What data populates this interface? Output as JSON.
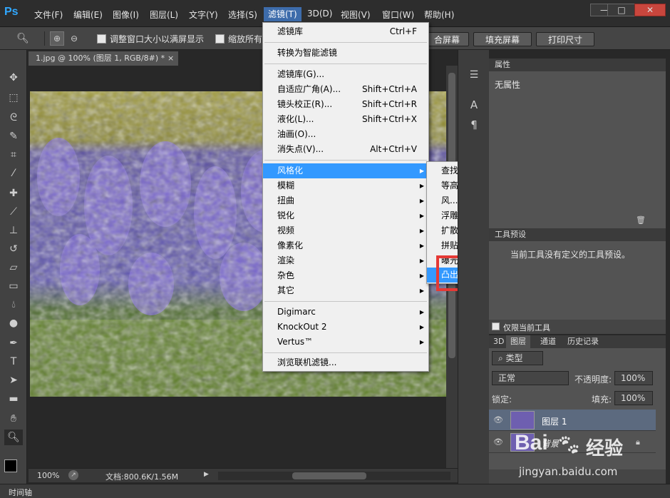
{
  "app": {
    "logo": "Ps"
  },
  "menubar": {
    "items": [
      "文件(F)",
      "编辑(E)",
      "图像(I)",
      "图层(L)",
      "文字(Y)",
      "选择(S)",
      "滤镜(T)",
      "3D(D)",
      "视图(V)",
      "窗口(W)",
      "帮助(H)"
    ]
  },
  "window_buttons": {
    "min": "—",
    "restore": "□",
    "close": "✕"
  },
  "options": {
    "resize_window": "调整窗口大小以满屏显示",
    "zoom_all": "缩放所有",
    "fit_screen": "合屏幕",
    "fill_screen": "填充屏幕",
    "print_size": "打印尺寸"
  },
  "document": {
    "tab": "1.jpg @ 100% (图层 1, RGB/8#) *",
    "tab_close": "×"
  },
  "status": {
    "zoom": "100%",
    "doc": "文档:800.6K/1.56M"
  },
  "timeline": {
    "label": "时间轴"
  },
  "filter_menu": {
    "filter_gallery_top": "滤镜库",
    "filter_gallery_top_sc": "Ctrl+F",
    "smart_filter": "转换为智能滤镜",
    "filter_gallery": "滤镜库(G)...",
    "adaptive_wide": "自适应广角(A)...",
    "adaptive_wide_sc": "Shift+Ctrl+A",
    "lens_correction": "镜头校正(R)...",
    "lens_correction_sc": "Shift+Ctrl+R",
    "liquify": "液化(L)...",
    "liquify_sc": "Shift+Ctrl+X",
    "oil_paint": "油画(O)...",
    "vanishing_point": "消失点(V)...",
    "vanishing_point_sc": "Alt+Ctrl+V",
    "stylize": "风格化",
    "blur": "模糊",
    "distort": "扭曲",
    "sharpen": "锐化",
    "video": "视频",
    "pixelate": "像素化",
    "render": "渲染",
    "noise": "杂色",
    "other": "其它",
    "digimarc": "Digimarc",
    "knockout": "KnockOut 2",
    "vertus": "Vertus™",
    "browse_online": "浏览联机滤镜..."
  },
  "stylize_menu": {
    "items": [
      "查找边缘",
      "等高线...",
      "风...",
      "浮雕效果...",
      "扩散...",
      "拼贴...",
      "曝光过度",
      "凸出..."
    ]
  },
  "properties": {
    "tab": "属性",
    "text": "无属性"
  },
  "tool_presets": {
    "tab": "工具预设",
    "text": "当前工具没有定义的工具预设。",
    "current_only": "仅限当前工具"
  },
  "layers_panel": {
    "tabs": [
      "3D",
      "图层",
      "通道",
      "历史记录"
    ],
    "kind": "类型",
    "blend": "正常",
    "opacity_label": "不透明度:",
    "opacity": "100%",
    "lock_label": "锁定:",
    "fill_label": "填充:",
    "fill": "100%",
    "layers": [
      {
        "name": "图层 1"
      },
      {
        "name": "背景"
      }
    ]
  },
  "watermark": {
    "brand": "Bai",
    "brand2": "经验",
    "url": "jingyan.baidu.com"
  },
  "colors": {
    "accent": "#3399ff",
    "highlight_box": "#e53935",
    "menu_bg": "#f0f0f0"
  }
}
